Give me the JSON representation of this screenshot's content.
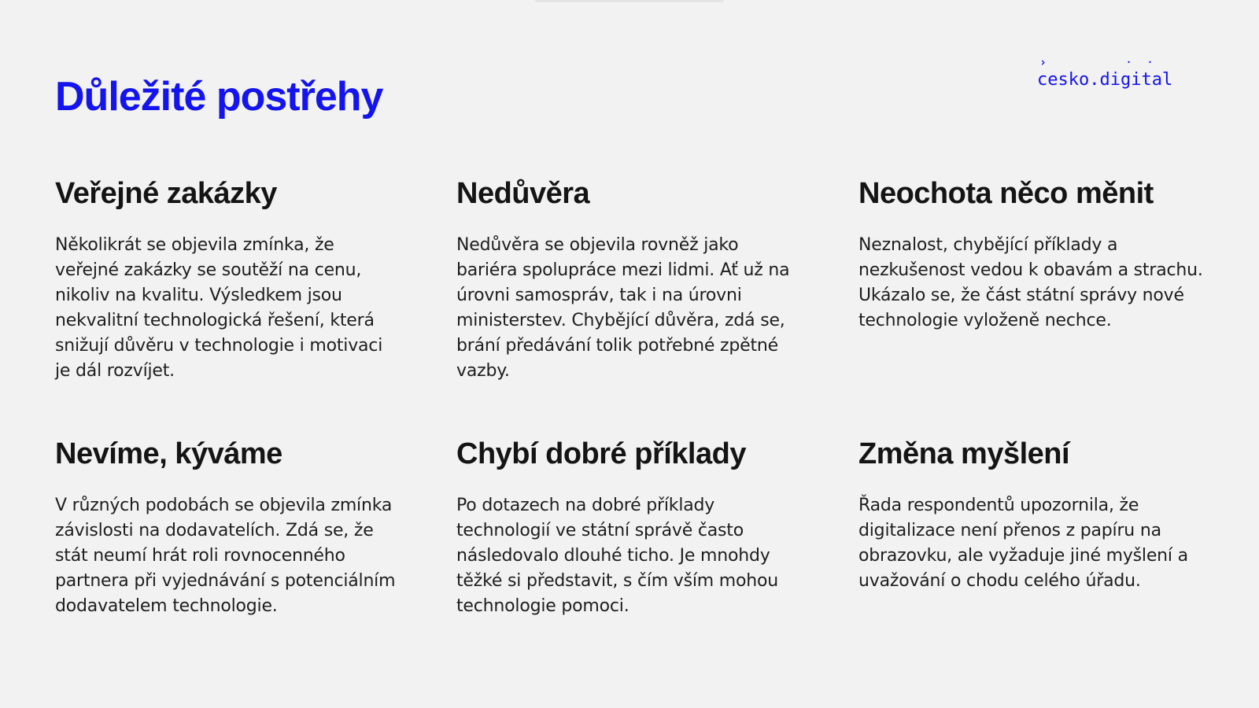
{
  "slide": {
    "title": "Důležité postřehy"
  },
  "logo": {
    "chevron": "›",
    "dots": "··",
    "text": "cesko.digital",
    "color": "#1414ee"
  },
  "cards": [
    {
      "heading": "Veřejné zakázky",
      "body": "Několikrát se objevila zmínka, že veřejné zakázky se soutěží na cenu, nikoliv na kvalitu. Výsledkem jsou nekvalitní technologická řešení, která snižují důvěru v technologie i motivaci je dál rozvíjet."
    },
    {
      "heading": "Nedůvěra",
      "body": "Nedůvěra se objevila rovněž jako bariéra spolupráce mezi lidmi. Ať už na úrovni samospráv, tak i na úrovni ministerstev. Chybějící důvěra, zdá se, brání předávání tolik potřebné zpětné vazby."
    },
    {
      "heading": "Neochota něco měnit",
      "body": "Neznalost, chybějící příklady a nezkušenost vedou k obavám a strachu. Ukázalo se, že část státní správy nové technologie vyloženě nechce."
    },
    {
      "heading": "Nevíme, kýváme",
      "body": "V různých podobách se objevila zmínka závislosti na dodavatelích. Zdá se, že stát neumí hrát roli rovnocenného partnera při vyjednávání s potenciálním dodavatelem technologie."
    },
    {
      "heading": "Chybí dobré příklady",
      "body": "Po dotazech na dobré příklady technologií ve státní správě často následovalo dlouhé ticho. Je mnohdy těžké si představit, s čím vším mohou technologie pomoci."
    },
    {
      "heading": "Změna myšlení",
      "body": "Řada respondentů upozornila, že digitalizace není přenos z papíru na obrazovku, ale vyžaduje jiné myšlení a uvažování o chodu celého úřadu."
    }
  ]
}
